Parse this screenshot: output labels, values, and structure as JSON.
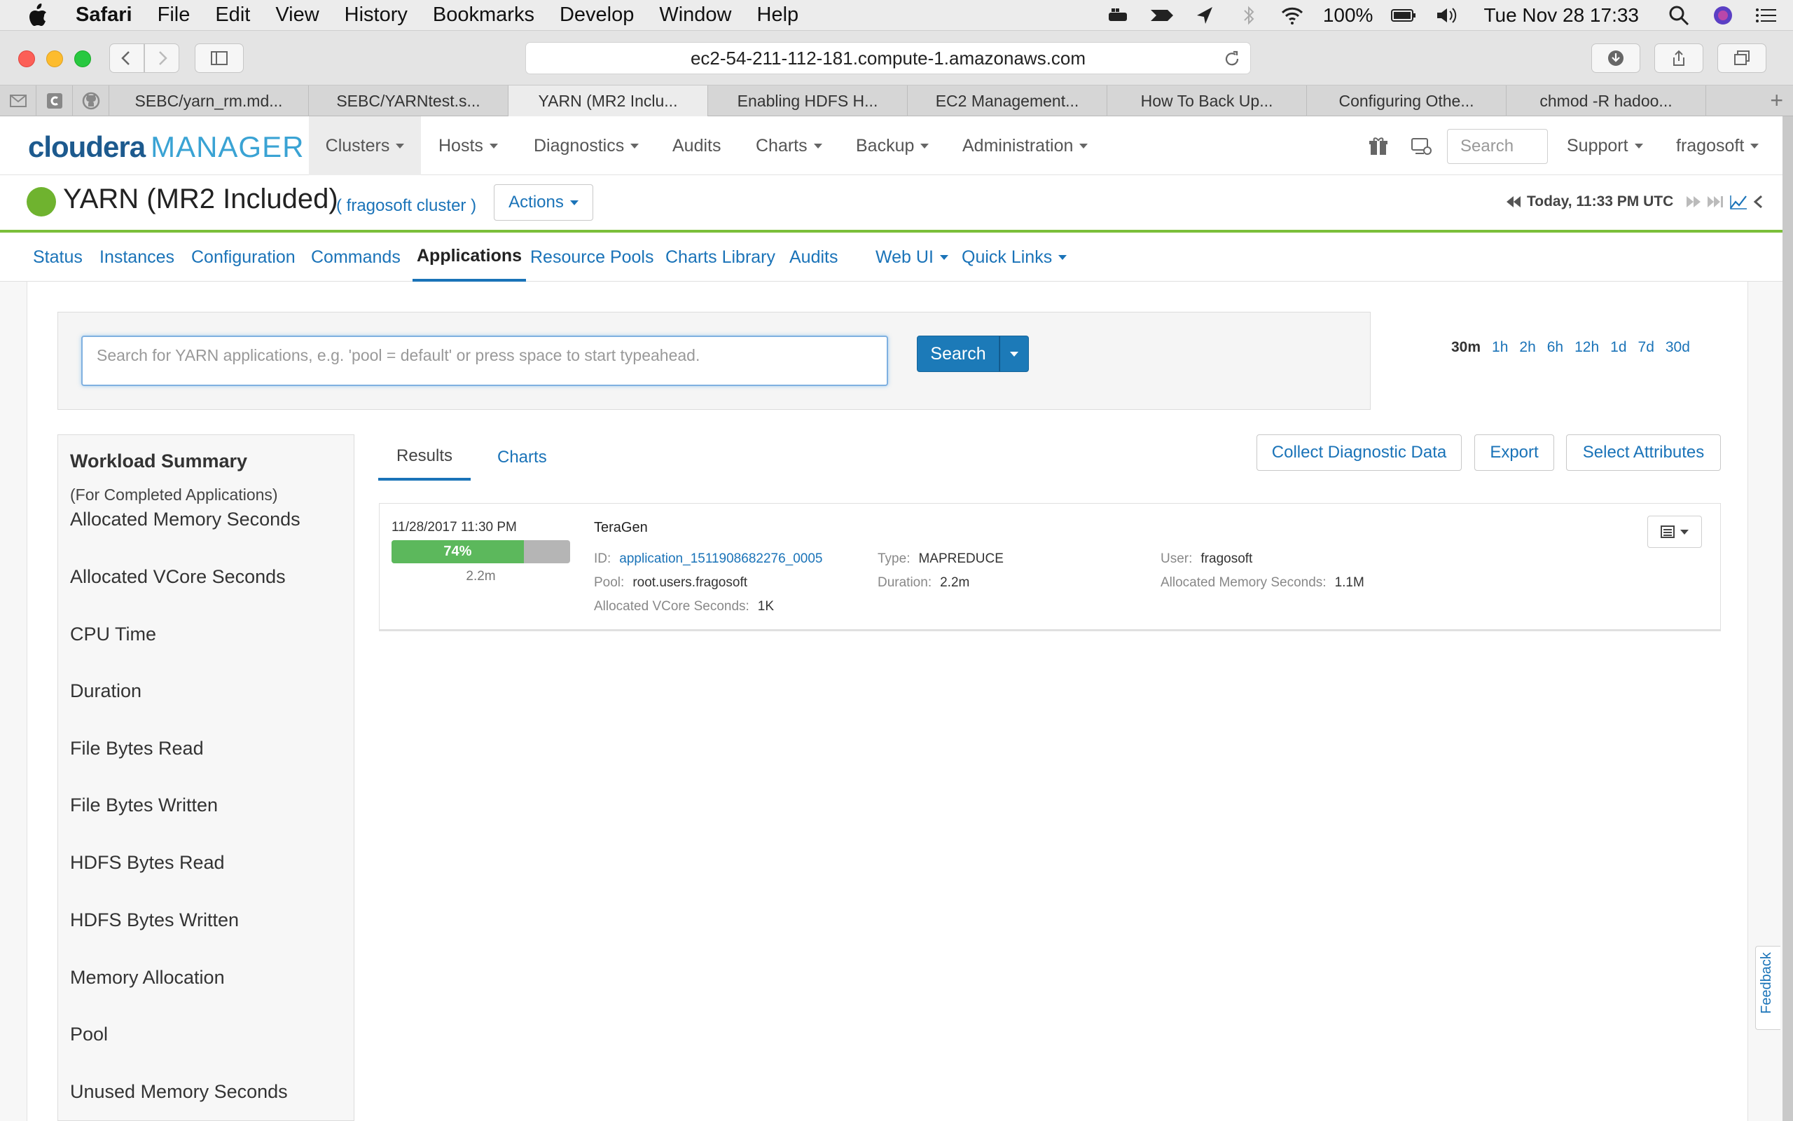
{
  "menubar": {
    "app": "Safari",
    "items": [
      "File",
      "Edit",
      "View",
      "History",
      "Bookmarks",
      "Develop",
      "Window",
      "Help"
    ],
    "battery": "100%",
    "datetime": "Tue Nov 28  17:33"
  },
  "browser": {
    "url": "ec2-54-211-112-181.compute-1.amazonaws.com",
    "tabs": [
      "SEBC/yarn_rm.md...",
      "SEBC/YARNtest.s...",
      "YARN (MR2 Inclu...",
      "Enabling HDFS H...",
      "EC2 Management...",
      "How To Back Up...",
      "Configuring Othe...",
      "chmod -R hadoo..."
    ],
    "active_tab": 2,
    "new_tab": "+"
  },
  "cm_nav": {
    "logo_a": "cloudera",
    "logo_b": "MANAGER",
    "items": [
      "Clusters",
      "Hosts",
      "Diagnostics",
      "Audits",
      "Charts",
      "Backup",
      "Administration"
    ],
    "search_placeholder": "Search",
    "support": "Support",
    "user": "fragosoft"
  },
  "service": {
    "title": "YARN (MR2 Included)",
    "cluster": "( fragosoft cluster )",
    "actions": "Actions",
    "time": "Today, 11:33 PM UTC",
    "status_color": "#6fb32f"
  },
  "subnav": {
    "items": [
      "Status",
      "Instances",
      "Configuration",
      "Commands",
      "Applications",
      "Resource Pools",
      "Charts Library",
      "Audits",
      "Web UI",
      "Quick Links"
    ],
    "active": "Applications"
  },
  "search": {
    "placeholder": "Search for YARN applications, e.g. 'pool = default' or press space to start typeahead.",
    "button": "Search",
    "ranges": [
      "30m",
      "1h",
      "2h",
      "6h",
      "12h",
      "1d",
      "7d",
      "30d"
    ],
    "selected_range": "30m"
  },
  "workload": {
    "title": "Workload Summary",
    "subtitle": "(For Completed Applications)",
    "items": [
      "Allocated Memory Seconds",
      "Allocated VCore Seconds",
      "CPU Time",
      "Duration",
      "File Bytes Read",
      "File Bytes Written",
      "HDFS Bytes Read",
      "HDFS Bytes Written",
      "Memory Allocation",
      "Pool",
      "Unused Memory Seconds"
    ]
  },
  "results": {
    "tab_results": "Results",
    "tab_charts": "Charts",
    "buttons": [
      "Collect Diagnostic Data",
      "Export",
      "Select Attributes"
    ]
  },
  "app": {
    "date": "11/28/2017 11:30 PM",
    "progress_label": "74%",
    "progress": 0.74,
    "duration_short": "2.2m",
    "name": "TeraGen",
    "id_label": "ID:",
    "id": "application_1511908682276_0005",
    "type_label": "Type:",
    "type": "MAPREDUCE",
    "user_label": "User:",
    "user": "fragosoft",
    "pool_label": "Pool:",
    "pool": "root.users.fragosoft",
    "duration_label": "Duration:",
    "duration": "2.2m",
    "mem_label": "Allocated Memory Seconds:",
    "mem": "1.1M",
    "vcore_label": "Allocated VCore Seconds:",
    "vcore": "1K"
  },
  "feedback": "Feedback"
}
